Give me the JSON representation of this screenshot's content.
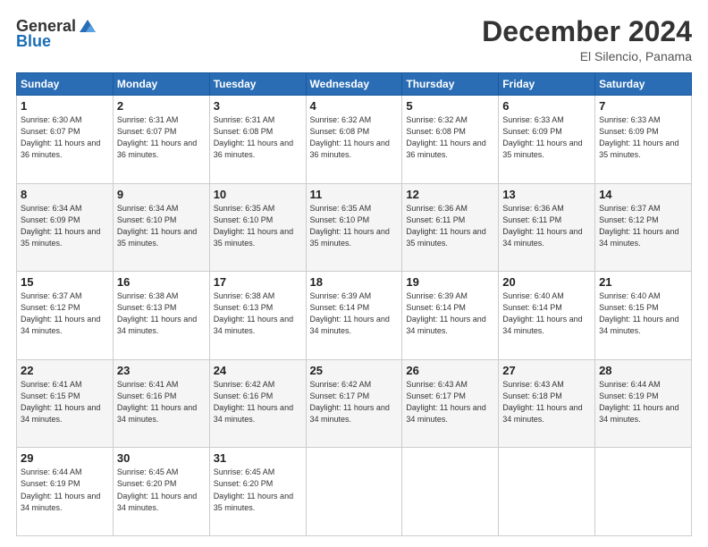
{
  "logo": {
    "general": "General",
    "blue": "Blue"
  },
  "header": {
    "month": "December 2024",
    "location": "El Silencio, Panama"
  },
  "weekdays": [
    "Sunday",
    "Monday",
    "Tuesday",
    "Wednesday",
    "Thursday",
    "Friday",
    "Saturday"
  ],
  "weeks": [
    [
      {
        "day": "1",
        "sunrise": "Sunrise: 6:30 AM",
        "sunset": "Sunset: 6:07 PM",
        "daylight": "Daylight: 11 hours and 36 minutes."
      },
      {
        "day": "2",
        "sunrise": "Sunrise: 6:31 AM",
        "sunset": "Sunset: 6:07 PM",
        "daylight": "Daylight: 11 hours and 36 minutes."
      },
      {
        "day": "3",
        "sunrise": "Sunrise: 6:31 AM",
        "sunset": "Sunset: 6:08 PM",
        "daylight": "Daylight: 11 hours and 36 minutes."
      },
      {
        "day": "4",
        "sunrise": "Sunrise: 6:32 AM",
        "sunset": "Sunset: 6:08 PM",
        "daylight": "Daylight: 11 hours and 36 minutes."
      },
      {
        "day": "5",
        "sunrise": "Sunrise: 6:32 AM",
        "sunset": "Sunset: 6:08 PM",
        "daylight": "Daylight: 11 hours and 36 minutes."
      },
      {
        "day": "6",
        "sunrise": "Sunrise: 6:33 AM",
        "sunset": "Sunset: 6:09 PM",
        "daylight": "Daylight: 11 hours and 35 minutes."
      },
      {
        "day": "7",
        "sunrise": "Sunrise: 6:33 AM",
        "sunset": "Sunset: 6:09 PM",
        "daylight": "Daylight: 11 hours and 35 minutes."
      }
    ],
    [
      {
        "day": "8",
        "sunrise": "Sunrise: 6:34 AM",
        "sunset": "Sunset: 6:09 PM",
        "daylight": "Daylight: 11 hours and 35 minutes."
      },
      {
        "day": "9",
        "sunrise": "Sunrise: 6:34 AM",
        "sunset": "Sunset: 6:10 PM",
        "daylight": "Daylight: 11 hours and 35 minutes."
      },
      {
        "day": "10",
        "sunrise": "Sunrise: 6:35 AM",
        "sunset": "Sunset: 6:10 PM",
        "daylight": "Daylight: 11 hours and 35 minutes."
      },
      {
        "day": "11",
        "sunrise": "Sunrise: 6:35 AM",
        "sunset": "Sunset: 6:10 PM",
        "daylight": "Daylight: 11 hours and 35 minutes."
      },
      {
        "day": "12",
        "sunrise": "Sunrise: 6:36 AM",
        "sunset": "Sunset: 6:11 PM",
        "daylight": "Daylight: 11 hours and 35 minutes."
      },
      {
        "day": "13",
        "sunrise": "Sunrise: 6:36 AM",
        "sunset": "Sunset: 6:11 PM",
        "daylight": "Daylight: 11 hours and 34 minutes."
      },
      {
        "day": "14",
        "sunrise": "Sunrise: 6:37 AM",
        "sunset": "Sunset: 6:12 PM",
        "daylight": "Daylight: 11 hours and 34 minutes."
      }
    ],
    [
      {
        "day": "15",
        "sunrise": "Sunrise: 6:37 AM",
        "sunset": "Sunset: 6:12 PM",
        "daylight": "Daylight: 11 hours and 34 minutes."
      },
      {
        "day": "16",
        "sunrise": "Sunrise: 6:38 AM",
        "sunset": "Sunset: 6:13 PM",
        "daylight": "Daylight: 11 hours and 34 minutes."
      },
      {
        "day": "17",
        "sunrise": "Sunrise: 6:38 AM",
        "sunset": "Sunset: 6:13 PM",
        "daylight": "Daylight: 11 hours and 34 minutes."
      },
      {
        "day": "18",
        "sunrise": "Sunrise: 6:39 AM",
        "sunset": "Sunset: 6:14 PM",
        "daylight": "Daylight: 11 hours and 34 minutes."
      },
      {
        "day": "19",
        "sunrise": "Sunrise: 6:39 AM",
        "sunset": "Sunset: 6:14 PM",
        "daylight": "Daylight: 11 hours and 34 minutes."
      },
      {
        "day": "20",
        "sunrise": "Sunrise: 6:40 AM",
        "sunset": "Sunset: 6:14 PM",
        "daylight": "Daylight: 11 hours and 34 minutes."
      },
      {
        "day": "21",
        "sunrise": "Sunrise: 6:40 AM",
        "sunset": "Sunset: 6:15 PM",
        "daylight": "Daylight: 11 hours and 34 minutes."
      }
    ],
    [
      {
        "day": "22",
        "sunrise": "Sunrise: 6:41 AM",
        "sunset": "Sunset: 6:15 PM",
        "daylight": "Daylight: 11 hours and 34 minutes."
      },
      {
        "day": "23",
        "sunrise": "Sunrise: 6:41 AM",
        "sunset": "Sunset: 6:16 PM",
        "daylight": "Daylight: 11 hours and 34 minutes."
      },
      {
        "day": "24",
        "sunrise": "Sunrise: 6:42 AM",
        "sunset": "Sunset: 6:16 PM",
        "daylight": "Daylight: 11 hours and 34 minutes."
      },
      {
        "day": "25",
        "sunrise": "Sunrise: 6:42 AM",
        "sunset": "Sunset: 6:17 PM",
        "daylight": "Daylight: 11 hours and 34 minutes."
      },
      {
        "day": "26",
        "sunrise": "Sunrise: 6:43 AM",
        "sunset": "Sunset: 6:17 PM",
        "daylight": "Daylight: 11 hours and 34 minutes."
      },
      {
        "day": "27",
        "sunrise": "Sunrise: 6:43 AM",
        "sunset": "Sunset: 6:18 PM",
        "daylight": "Daylight: 11 hours and 34 minutes."
      },
      {
        "day": "28",
        "sunrise": "Sunrise: 6:44 AM",
        "sunset": "Sunset: 6:19 PM",
        "daylight": "Daylight: 11 hours and 34 minutes."
      }
    ],
    [
      {
        "day": "29",
        "sunrise": "Sunrise: 6:44 AM",
        "sunset": "Sunset: 6:19 PM",
        "daylight": "Daylight: 11 hours and 34 minutes."
      },
      {
        "day": "30",
        "sunrise": "Sunrise: 6:45 AM",
        "sunset": "Sunset: 6:20 PM",
        "daylight": "Daylight: 11 hours and 34 minutes."
      },
      {
        "day": "31",
        "sunrise": "Sunrise: 6:45 AM",
        "sunset": "Sunset: 6:20 PM",
        "daylight": "Daylight: 11 hours and 35 minutes."
      },
      null,
      null,
      null,
      null
    ]
  ]
}
